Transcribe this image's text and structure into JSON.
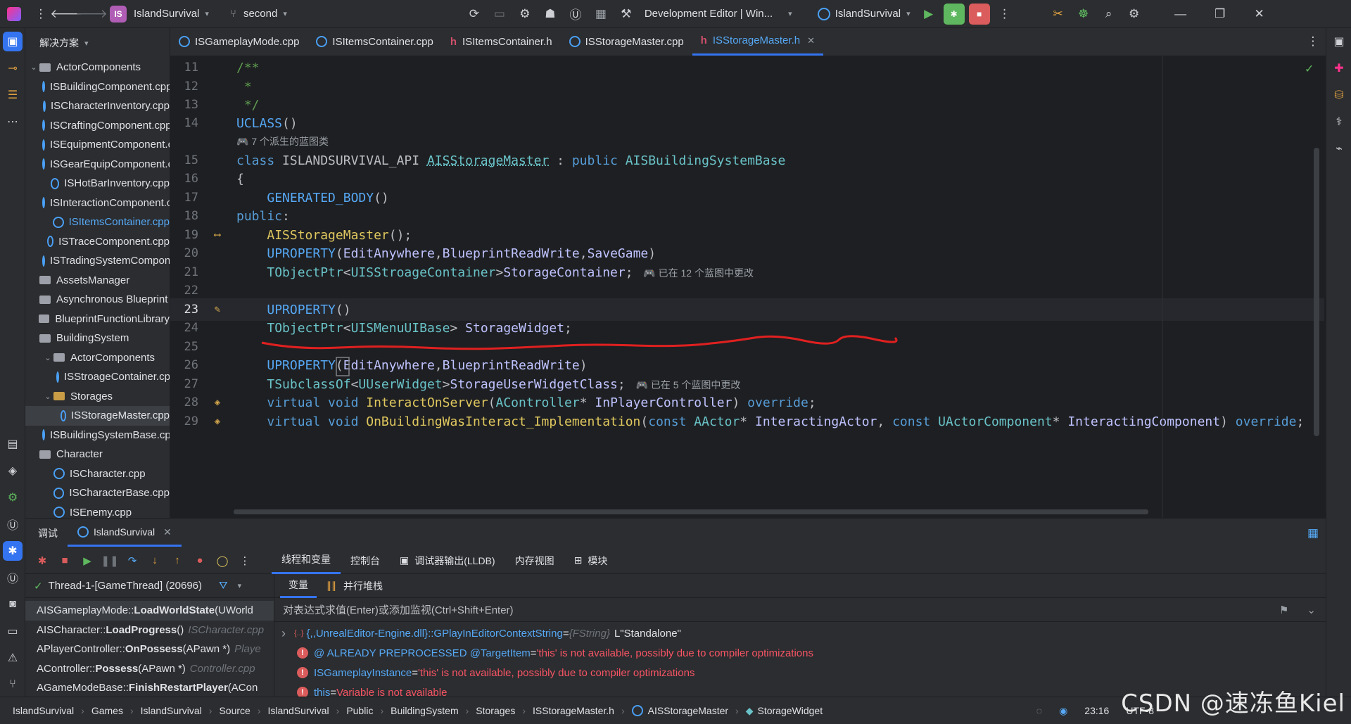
{
  "titlebar": {
    "project_name": "IslandSurvival",
    "project_chip": "IS",
    "branch": "second",
    "config": "Development Editor | Win...",
    "run_target": "IslandSurvival"
  },
  "project_panel": {
    "title": "解决方案",
    "items": [
      {
        "label": "ActorComponents",
        "type": "folder",
        "depth": 0,
        "expanded": true
      },
      {
        "label": "ISBuildingComponent.cpp",
        "type": "cpp",
        "depth": 1
      },
      {
        "label": "ISCharacterInventory.cpp",
        "type": "cpp",
        "depth": 1
      },
      {
        "label": "ISCraftingComponent.cpp",
        "type": "cpp",
        "depth": 1
      },
      {
        "label": "ISEquipmentComponent.cpp",
        "type": "cpp",
        "depth": 1
      },
      {
        "label": "ISGearEquipComponent.cpp",
        "type": "cpp",
        "depth": 1
      },
      {
        "label": "ISHotBarInventory.cpp",
        "type": "cpp",
        "depth": 1
      },
      {
        "label": "ISInteractionComponent.cpp",
        "type": "cpp",
        "depth": 1
      },
      {
        "label": "ISItemsContainer.cpp",
        "type": "cpp",
        "depth": 1,
        "highlight": true
      },
      {
        "label": "ISTraceComponent.cpp",
        "type": "cpp",
        "depth": 1
      },
      {
        "label": "ISTradingSystemComponent.cpp",
        "type": "cpp",
        "depth": 1
      },
      {
        "label": "AssetsManager",
        "type": "folder",
        "depth": 0
      },
      {
        "label": "Asynchronous Blueprint",
        "type": "folder",
        "depth": 0
      },
      {
        "label": "BlueprintFunctionLibrary",
        "type": "folder",
        "depth": 0
      },
      {
        "label": "BuildingSystem",
        "type": "folder",
        "depth": 0
      },
      {
        "label": "ActorComponents",
        "type": "folder",
        "depth": 1,
        "expanded": true
      },
      {
        "label": "ISStroageContainer.cpp",
        "type": "cpp",
        "depth": 2
      },
      {
        "label": "Storages",
        "type": "folder-orange",
        "depth": 1,
        "expanded": true
      },
      {
        "label": "ISStorageMaster.cpp",
        "type": "cpp",
        "depth": 2,
        "selected": true
      },
      {
        "label": "ISBuildingSystemBase.cpp",
        "type": "cpp",
        "depth": 1
      },
      {
        "label": "Character",
        "type": "folder",
        "depth": 0
      },
      {
        "label": "ISCharacter.cpp",
        "type": "cpp",
        "depth": 1
      },
      {
        "label": "ISCharacterBase.cpp",
        "type": "cpp",
        "depth": 1
      },
      {
        "label": "ISEnemy.cpp",
        "type": "cpp",
        "depth": 1
      }
    ]
  },
  "tabs": [
    {
      "label": "ISGameplayMode.cpp",
      "kind": "cpp"
    },
    {
      "label": "ISItemsContainer.cpp",
      "kind": "cpp"
    },
    {
      "label": "ISItemsContainer.h",
      "kind": "h"
    },
    {
      "label": "ISStorageMaster.cpp",
      "kind": "cpp"
    },
    {
      "label": "ISStorageMaster.h",
      "kind": "h",
      "active": true
    }
  ],
  "editor": {
    "hint_derived": "7 个派生的蓝图类",
    "hint_changed_12": "已在 12 个蓝图中更改",
    "hint_changed_5": "已在 5 个蓝图中更改",
    "line_numbers": [
      "11",
      "12",
      "13",
      "14",
      "15",
      "16",
      "17",
      "18",
      "19",
      "20",
      "21",
      "22",
      "23",
      "24",
      "25",
      "26",
      "27",
      "28",
      "29"
    ]
  },
  "debug": {
    "tab_label": "调试",
    "session": "IslandSurvival",
    "subtabs": [
      "线程和变量",
      "控制台",
      "调试器输出(LLDB)",
      "内存视图",
      "模块"
    ],
    "thread": "Thread-1-[GameThread] (20696)",
    "var_tabs": [
      "变量",
      "并行堆栈"
    ],
    "eval_placeholder": "对表达式求值(Enter)或添加监视(Ctrl+Shift+Enter)",
    "frames": [
      {
        "cls": "AISGameplayMode::",
        "fn": "LoadWorldState",
        "args": "(UWorld",
        "file": ""
      },
      {
        "cls": "AISCharacter::",
        "fn": "LoadProgress",
        "args": "()",
        "file": "ISCharacter.cpp"
      },
      {
        "cls": "APlayerController::",
        "fn": "OnPossess",
        "args": "(APawn *)",
        "file": "Playe"
      },
      {
        "cls": "AController::",
        "fn": "Possess",
        "args": "(APawn *)",
        "file": "Controller.cpp"
      },
      {
        "cls": "AGameModeBase::",
        "fn": "FinishRestartPlayer",
        "args": "(ACon",
        "file": ""
      }
    ],
    "vars": [
      {
        "name": "{,,UnrealEditor-Engine.dll}::GPlayInEditorContextString",
        "eq": " = ",
        "type": "{FString}",
        "value": "L\"Standalone\""
      },
      {
        "name": "@ ALREADY PREPROCESSED @TargetItem",
        "eq": " = ",
        "value": "'this' is not available, possibly due to compiler optimizations"
      },
      {
        "name": "ISGameplayInstance",
        "eq": " = ",
        "value": "'this' is not available, possibly due to compiler optimizations"
      },
      {
        "name": "this",
        "eq": " = ",
        "value": "Variable is not available"
      }
    ]
  },
  "statusbar": {
    "crumbs": [
      "IslandSurvival",
      "Games",
      "IslandSurvival",
      "Source",
      "IslandSurvival",
      "Public",
      "BuildingSystem",
      "Storages",
      "ISStorageMaster.h",
      "AISStorageMaster",
      "StorageWidget"
    ],
    "position": "23:16",
    "encoding": "UTF-8",
    "watermark": "CSDN @速冻鱼Kiel"
  },
  "colors": {
    "accent": "#3574f0",
    "panel": "#2b2d30",
    "editor_bg": "#1e1f22",
    "squiggle": "#e02020"
  }
}
